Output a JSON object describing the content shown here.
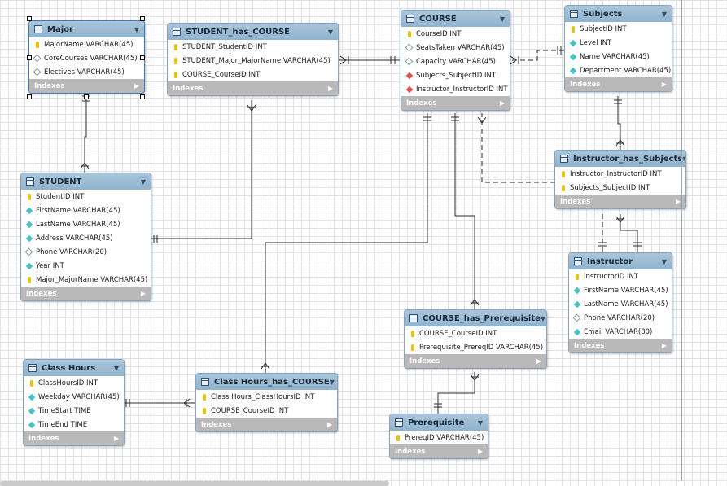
{
  "tables": [
    {
      "key": "major",
      "name": "Major",
      "selected": true,
      "columns": [
        {
          "text": "MajorName VARCHAR(45)",
          "icon": "pk"
        },
        {
          "text": "CoreCourses VARCHAR(45)",
          "icon": "nu"
        },
        {
          "text": "Electives VARCHAR(45)",
          "icon": "nu"
        }
      ],
      "indexes_label": "Indexes"
    },
    {
      "key": "student_has_course",
      "name": "STUDENT_has_COURSE",
      "columns": [
        {
          "text": "STUDENT_StudentID INT",
          "icon": "pk"
        },
        {
          "text": "STUDENT_Major_MajorName VARCHAR(45)",
          "icon": "pk"
        },
        {
          "text": "COURSE_CourseID INT",
          "icon": "pk"
        }
      ],
      "indexes_label": "Indexes"
    },
    {
      "key": "course",
      "name": "COURSE",
      "columns": [
        {
          "text": "CourseID INT",
          "icon": "pk"
        },
        {
          "text": "SeatsTaken VARCHAR(45)",
          "icon": "nu"
        },
        {
          "text": "Capacity VARCHAR(45)",
          "icon": "nu"
        },
        {
          "text": "Subjects_SubjectID INT",
          "icon": "fk"
        },
        {
          "text": "Instructor_InstructorID INT",
          "icon": "fk"
        }
      ],
      "indexes_label": "Indexes"
    },
    {
      "key": "subjects",
      "name": "Subjects",
      "columns": [
        {
          "text": "SubjectID INT",
          "icon": "pk"
        },
        {
          "text": "Level INT",
          "icon": "nn"
        },
        {
          "text": "Name VARCHAR(45)",
          "icon": "nn"
        },
        {
          "text": "Department VARCHAR(45)",
          "icon": "nn"
        }
      ],
      "indexes_label": "Indexes"
    },
    {
      "key": "student",
      "name": "STUDENT",
      "columns": [
        {
          "text": "StudentID INT",
          "icon": "pk"
        },
        {
          "text": "FirstName VARCHAR(45)",
          "icon": "nn"
        },
        {
          "text": "LastName VARCHAR(45)",
          "icon": "nn"
        },
        {
          "text": "Address VARCHAR(45)",
          "icon": "nn"
        },
        {
          "text": "Phone VARCHAR(20)",
          "icon": "nu"
        },
        {
          "text": "Year INT",
          "icon": "nn"
        },
        {
          "text": "Major_MajorName VARCHAR(45)",
          "icon": "pk"
        }
      ],
      "indexes_label": "Indexes"
    },
    {
      "key": "instructor_has_subjects",
      "name": "Instructor_has_Subjects",
      "columns": [
        {
          "text": "Instructor_InstructorID INT",
          "icon": "pk"
        },
        {
          "text": "Subjects_SubjectID INT",
          "icon": "pk"
        }
      ],
      "indexes_label": "Indexes"
    },
    {
      "key": "instructor",
      "name": "Instructor",
      "columns": [
        {
          "text": "InstructorID INT",
          "icon": "pk"
        },
        {
          "text": "FirstName VARCHAR(45)",
          "icon": "nn"
        },
        {
          "text": "LastName VARCHAR(45)",
          "icon": "nn"
        },
        {
          "text": "Phone VARCHAR(20)",
          "icon": "nu"
        },
        {
          "text": "Email VARCHAR(80)",
          "icon": "nn"
        }
      ],
      "indexes_label": "Indexes"
    },
    {
      "key": "course_has_prerequisite",
      "name": "COURSE_has_Prerequisite",
      "columns": [
        {
          "text": "COURSE_CourseID INT",
          "icon": "pk"
        },
        {
          "text": "Prerequisite_PrereqID VARCHAR(45)",
          "icon": "pk"
        }
      ],
      "indexes_label": "Indexes"
    },
    {
      "key": "class_hours",
      "name": "Class Hours",
      "columns": [
        {
          "text": "ClassHoursID INT",
          "icon": "pk"
        },
        {
          "text": "Weekday VARCHAR(45)",
          "icon": "nn"
        },
        {
          "text": "TimeStart TIME",
          "icon": "nn"
        },
        {
          "text": "TimeEnd TIME",
          "icon": "nn"
        }
      ],
      "indexes_label": "Indexes"
    },
    {
      "key": "class_hours_has_course",
      "name": "Class Hours_has_COURSE",
      "columns": [
        {
          "text": "Class Hours_ClassHoursID INT",
          "icon": "pk"
        },
        {
          "text": "COURSE_CourseID INT",
          "icon": "pk"
        }
      ],
      "indexes_label": "Indexes"
    },
    {
      "key": "prerequisite",
      "name": "Prerequisite",
      "columns": [
        {
          "text": "PrereqID VARCHAR(45)",
          "icon": "pk"
        }
      ],
      "indexes_label": "Indexes"
    }
  ],
  "relationships": [
    {
      "from": "Major",
      "to": "STUDENT",
      "identifying": true
    },
    {
      "from": "STUDENT",
      "to": "STUDENT_has_COURSE",
      "identifying": true
    },
    {
      "from": "COURSE",
      "to": "STUDENT_has_COURSE",
      "identifying": true
    },
    {
      "from": "Subjects",
      "to": "COURSE",
      "identifying": false
    },
    {
      "from": "Subjects",
      "to": "Instructor_has_Subjects",
      "identifying": true
    },
    {
      "from": "Instructor",
      "to": "Instructor_has_Subjects",
      "identifying": true
    },
    {
      "from": "Instructor",
      "to": "COURSE",
      "identifying": false
    },
    {
      "from": "COURSE",
      "to": "COURSE_has_Prerequisite",
      "identifying": true
    },
    {
      "from": "Prerequisite",
      "to": "COURSE_has_Prerequisite",
      "identifying": true
    },
    {
      "from": "COURSE",
      "to": "Class Hours_has_COURSE",
      "identifying": true
    },
    {
      "from": "Class Hours",
      "to": "Class Hours_has_COURSE",
      "identifying": true
    }
  ]
}
